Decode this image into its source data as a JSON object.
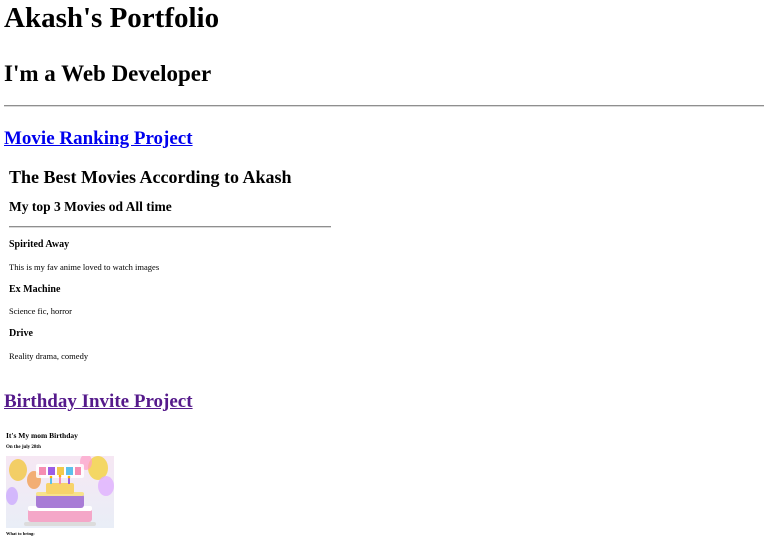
{
  "header": {
    "title": "Akash's Portfolio",
    "subtitle": "I'm a Web Developer"
  },
  "projects": [
    {
      "link_text": "Movie Ranking Project",
      "visited": false,
      "content": {
        "heading": "The Best Movies According to Akash",
        "subheading": "My top 3 Movies od All time",
        "movies": [
          {
            "title": "Spirited Away",
            "description": "This is my fav anime loved to watch images"
          },
          {
            "title": "Ex Machine",
            "description": "Science fic, horror"
          },
          {
            "title": "Drive",
            "description": "Reality drama, comedy"
          }
        ]
      }
    },
    {
      "link_text": "Birthday Invite Project",
      "visited": true,
      "content": {
        "heading": "It's My mom Birthday",
        "date_line": "On the july 28th",
        "image_alt": "birthday-cake-image",
        "footer_text": "What to bring:"
      }
    }
  ],
  "colors": {
    "link_unvisited": "#0000ee",
    "link_visited": "#551a8b",
    "rule": "#8f8f8f"
  }
}
